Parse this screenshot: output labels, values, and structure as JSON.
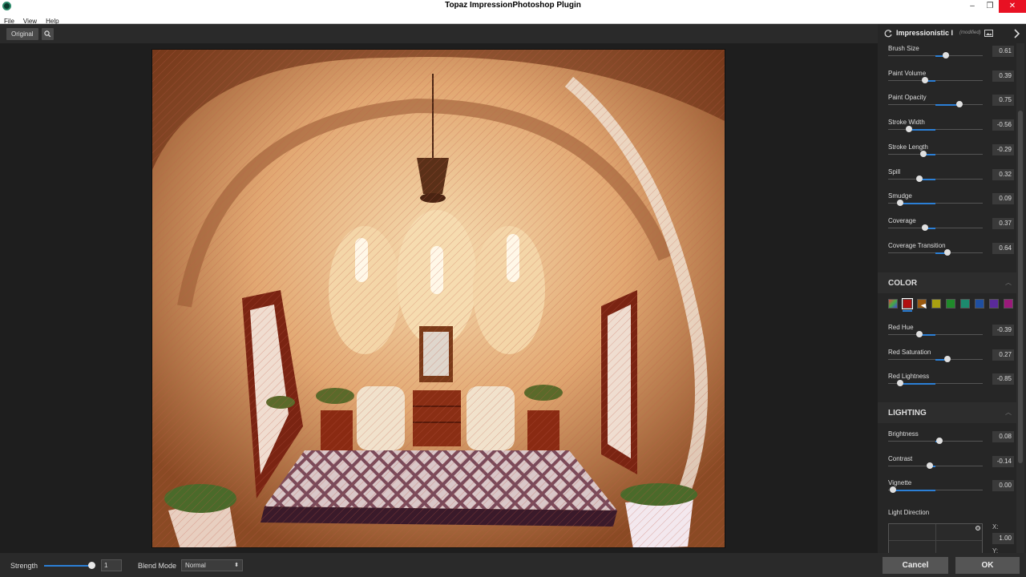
{
  "window": {
    "title": "Topaz ImpressionPhotoshop Plugin",
    "controls": {
      "minimize": "–",
      "restore": "❐",
      "close": "✕"
    }
  },
  "menu": [
    "File",
    "View",
    "Help"
  ],
  "toolbar": {
    "original_label": "Original",
    "zoom_icon": "magnifier-icon"
  },
  "preset": {
    "name": "Impressionistic I",
    "modified": "(modified)"
  },
  "brush_sliders": [
    {
      "label": "Brush Size",
      "value": "0.61",
      "pos": 0.61
    },
    {
      "label": "Paint Volume",
      "value": "0.39",
      "pos": 0.39
    },
    {
      "label": "Paint Opacity",
      "value": "0.75",
      "pos": 0.75
    },
    {
      "label": "Stroke Width",
      "value": "-0.56",
      "pos": 0.22
    },
    {
      "label": "Stroke Length",
      "value": "-0.29",
      "pos": 0.37
    },
    {
      "label": "Spill",
      "value": "0.32",
      "pos": 0.33
    },
    {
      "label": "Smudge",
      "value": "0.09",
      "pos": 0.13
    },
    {
      "label": "Coverage",
      "value": "0.37",
      "pos": 0.39
    },
    {
      "label": "Coverage Transition",
      "value": "0.64",
      "pos": 0.63
    }
  ],
  "color": {
    "title": "COLOR",
    "swatches": [
      "#7b7bb8",
      "#b01010",
      "#9a5a10",
      "#a8a010",
      "#1f8a2a",
      "#1c8a6e",
      "#1f4fa0",
      "#5a2a9a",
      "#9a1a7a"
    ],
    "sliders": [
      {
        "label": "Red Hue",
        "value": "-0.39",
        "pos": 0.33
      },
      {
        "label": "Red Saturation",
        "value": "0.27",
        "pos": 0.63
      },
      {
        "label": "Red Lightness",
        "value": "-0.85",
        "pos": 0.13
      }
    ]
  },
  "lighting": {
    "title": "LIGHTING",
    "sliders": [
      {
        "label": "Brightness",
        "value": "0.08",
        "pos": 0.54
      },
      {
        "label": "Contrast",
        "value": "-0.14",
        "pos": 0.44
      },
      {
        "label": "Vignette",
        "value": "0.00",
        "pos": 0.05
      }
    ],
    "light_direction": {
      "label": "Light Direction",
      "x_label": "X:",
      "x_value": "1.00",
      "y_label": "Y:"
    }
  },
  "bottom": {
    "strength_label": "Strength",
    "strength_value": "1",
    "blend_label": "Blend Mode",
    "blend_value": "Normal",
    "cancel_label": "Cancel",
    "ok_label": "OK"
  }
}
